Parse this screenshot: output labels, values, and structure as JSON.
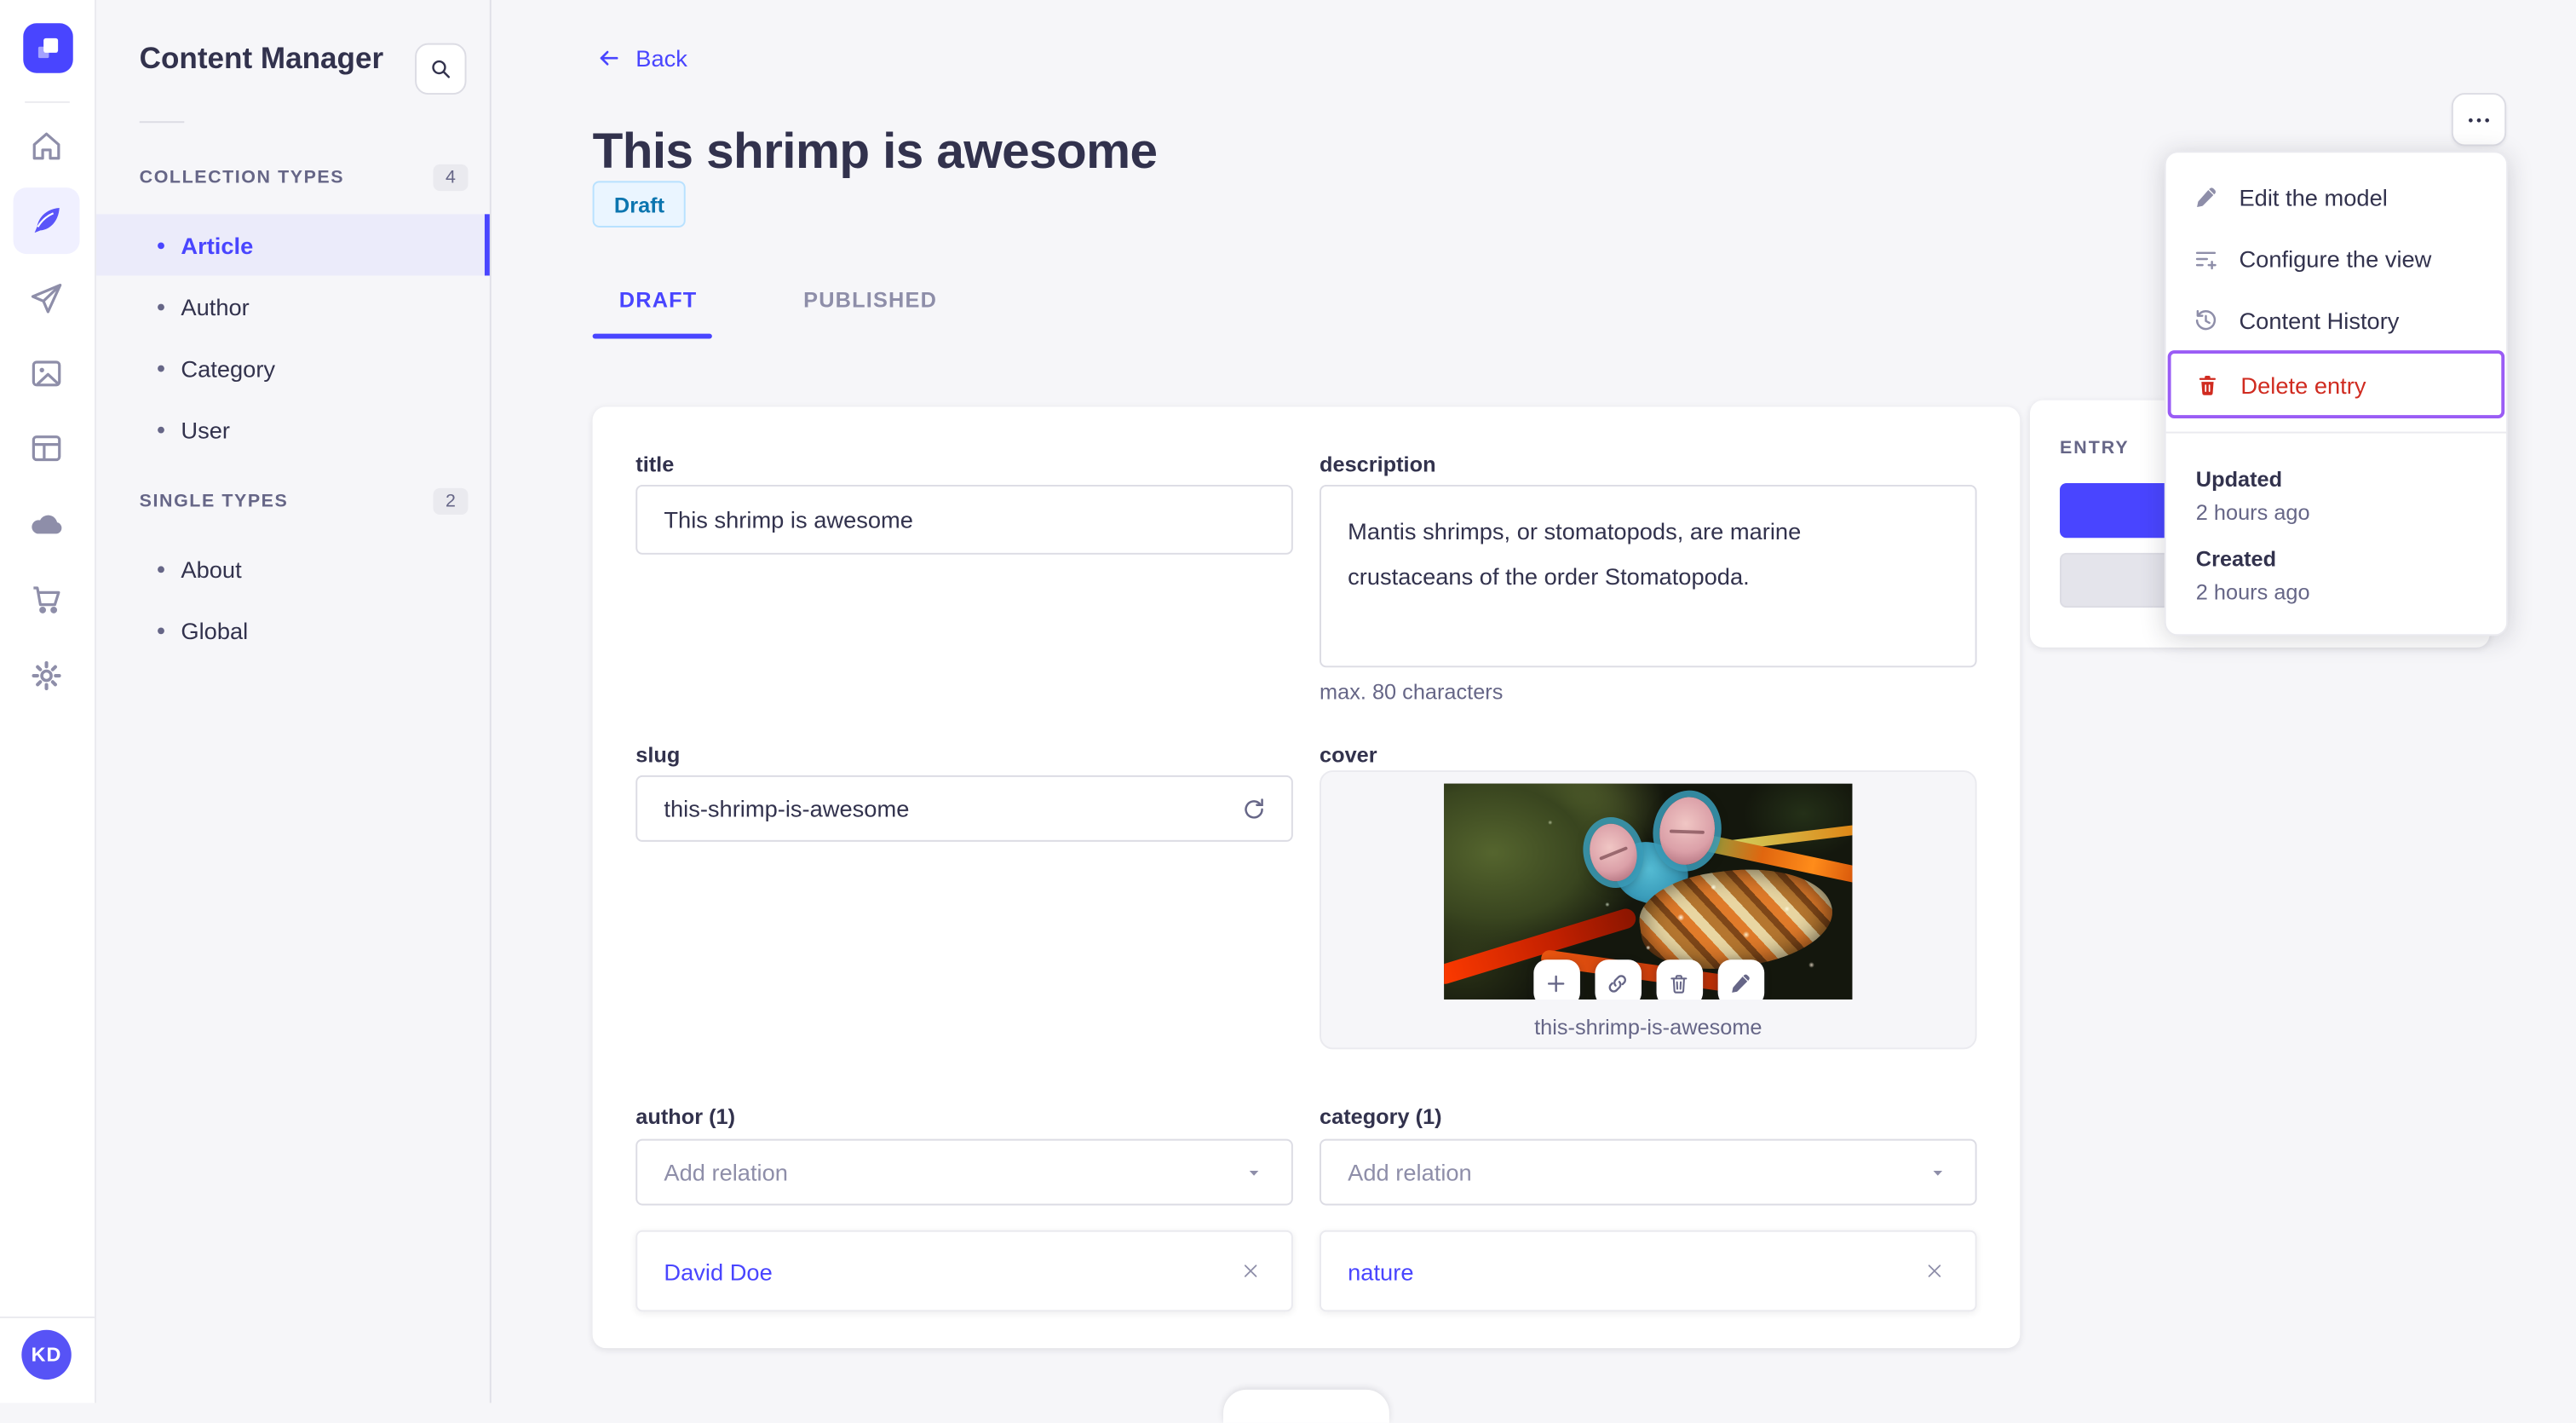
{
  "nav": {
    "icons": [
      "strapi-logo",
      "home",
      "content-manager",
      "releases",
      "media-library",
      "content-type-builder",
      "cloud",
      "marketplace",
      "settings"
    ],
    "active_icon": "content-manager",
    "avatar_initials": "KD"
  },
  "subnav": {
    "title": "Content Manager",
    "sections": [
      {
        "label": "COLLECTION TYPES",
        "count": "4",
        "items": [
          {
            "label": "Article",
            "active": true
          },
          {
            "label": "Author",
            "active": false
          },
          {
            "label": "Category",
            "active": false
          },
          {
            "label": "User",
            "active": false
          }
        ]
      },
      {
        "label": "SINGLE TYPES",
        "count": "2",
        "items": [
          {
            "label": "About",
            "active": false
          },
          {
            "label": "Global",
            "active": false
          }
        ]
      }
    ]
  },
  "header": {
    "back_label": "Back",
    "title": "This shrimp is awesome",
    "status_badge": "Draft",
    "tabs": [
      {
        "label": "DRAFT",
        "active": true
      },
      {
        "label": "PUBLISHED",
        "active": false
      }
    ]
  },
  "form": {
    "title": {
      "label": "title",
      "value": "This shrimp is awesome"
    },
    "description": {
      "label": "description",
      "value": "Mantis shrimps, or stomatopods, are marine crustaceans of the order Stomatopoda.",
      "hint": "max. 80 characters"
    },
    "slug": {
      "label": "slug",
      "value": "this-shrimp-is-awesome"
    },
    "cover": {
      "label": "cover",
      "filename": "this-shrimp-is-awesome",
      "action_icons": [
        "plus-icon",
        "link-icon",
        "trash-icon",
        "pencil-icon"
      ]
    },
    "author": {
      "label": "author (1)",
      "placeholder": "Add relation",
      "relations": [
        {
          "name": "David Doe"
        }
      ]
    },
    "category": {
      "label": "category (1)",
      "placeholder": "Add relation",
      "relations": [
        {
          "name": "nature"
        }
      ]
    }
  },
  "entry_panel": {
    "title": "ENTRY"
  },
  "context_menu": {
    "items": [
      {
        "label": "Edit the model",
        "icon": "pencil-icon",
        "danger": false,
        "highlighted": false
      },
      {
        "label": "Configure the view",
        "icon": "configure-icon",
        "danger": false,
        "highlighted": false
      },
      {
        "label": "Content History",
        "icon": "history-icon",
        "danger": false,
        "highlighted": false
      },
      {
        "label": "Delete entry",
        "icon": "trash-icon",
        "danger": true,
        "highlighted": true
      }
    ],
    "meta": [
      {
        "label": "Updated",
        "value": "2 hours ago"
      },
      {
        "label": "Created",
        "value": "2 hours ago"
      }
    ]
  },
  "colors": {
    "accent": "#4945ff",
    "accent_light_bg": "#ebebfa",
    "danger": "#d02b20",
    "highlight_outline": "#9a5cf5",
    "draft_bg": "#eaf5ff",
    "draft_border": "#b8e1ff",
    "draft_text": "#0c75af",
    "body_bg": "#f6f6f9",
    "border": "#dcdce4",
    "text_primary": "#32324d",
    "text_secondary": "#666687",
    "icon_gray": "#8e8ea9"
  }
}
